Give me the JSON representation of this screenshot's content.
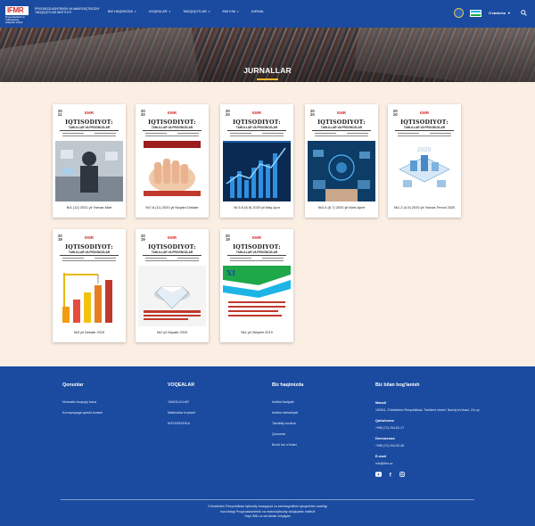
{
  "header": {
    "logo_text": "IFMR",
    "logo_sub": "Prognozlashtirish va makroiqtisodiy tadqiqotlar instituti",
    "org_name": "Prognozlashtirish va makroiqtisodiy tadqiqotlar instituti",
    "nav": [
      {
        "label": "Biz haqimizda",
        "has_caret": true
      },
      {
        "label": "Voqealar",
        "has_caret": true
      },
      {
        "label": "Tadqiqotlar",
        "has_caret": true
      },
      {
        "label": "Kim kim",
        "has_caret": true
      },
      {
        "label": "Jurnal",
        "has_caret": false
      }
    ],
    "language": "O'zbekcha",
    "colors": {
      "bar": "#1a4ba0",
      "flag_blue": "#1eb4e6",
      "flag_white": "#ffffff",
      "flag_green": "#1ea84a"
    }
  },
  "hero": {
    "title": "JURNALLAR",
    "accent": "#f2b632"
  },
  "journal_cover": {
    "masthead": "IQTISODIYOT:",
    "masthead_sub": "TAHLILLAR VA PROGNOZLAR",
    "publisher_mark": "EMR"
  },
  "journals": [
    {
      "caption": "№1 (12) 2021 yil Yanvar-Mart",
      "year_top": "20",
      "year_bottom": "21",
      "art": "tech"
    },
    {
      "caption": "№7-8 (11) 2020 yil Noyabr-Dekabr",
      "year_top": "20",
      "year_bottom": "20",
      "art": "hands"
    },
    {
      "caption": "№ 5-6 (8-9) 2020 yil May-Iyun",
      "year_top": "20",
      "year_bottom": "20",
      "art": "chart"
    },
    {
      "caption": "№3-4 (6-7) 2020 yil Mart-Aprel",
      "year_top": "20",
      "year_bottom": "20",
      "art": "digital"
    },
    {
      "caption": "№1-2 (4-5) 2020 yil Yanvar-Fevral 2020",
      "year_top": "20",
      "year_bottom": "20",
      "art": "isometric"
    },
    {
      "caption": "№3 yil Dekabr 2019",
      "year_top": "20",
      "year_bottom": "19",
      "art": "construction"
    },
    {
      "caption": "№2 yil Noyabr 2019",
      "year_top": "20",
      "year_bottom": "19",
      "art": "diamond"
    },
    {
      "caption": "№1 yil Oktyabr 2019",
      "year_top": "20",
      "year_bottom": "19",
      "art": "forum"
    }
  ],
  "footer": {
    "col1": {
      "title": "Qonunlar",
      "links": [
        "Normativ-huquqiy baza",
        "Korrupsiyaga qarshi kurash"
      ]
    },
    "col2": {
      "title": "VOQEALAR",
      "links": [
        "YANGILIKLAR",
        "Materiallar to'plami",
        "INFOGRAFIKA"
      ]
    },
    "col3": {
      "title": "Biz haqimizda",
      "links": [
        "Institut faoliyati",
        "Institut rahbariyati",
        "Tashkiliy tuzilma",
        "Qonunlar",
        "Bo'sh ish o'rinlari"
      ]
    },
    "col4": {
      "title": "Biz bilan bog'lanish",
      "address_label": "Manzil",
      "address": "100011, O'zbekiston Respublikasi, Toshkent shahri, Navoiy ko'chasi, 2/4-uy",
      "phone_label": "Qabulxona",
      "phone": "+998 (71) 244-61-17",
      "office_label": "Devonxona",
      "office": "+998 (71) 244-02-48",
      "email_label": "E-mail",
      "email": "info@ifmr.uz"
    },
    "copyright_line1": "O'zbekiston Respublikasi Iqtisodiy taraqqiyot va kambag'allikni qisqartirish vazirligi",
    "copyright_line2": "huzuridagi Prognozlashtirish va makroiqtisodiy tadqiqotlar instituti",
    "copyright_line3": "Sayt IMD.uz da ishlab chiqilgan"
  }
}
